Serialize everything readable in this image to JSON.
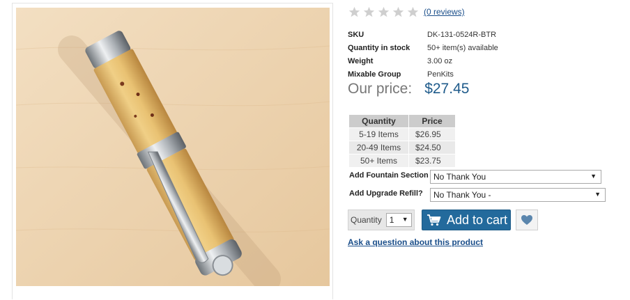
{
  "product": {
    "image_alt": "Fountain pen with burl wood body and chrome trim"
  },
  "rating": {
    "stars_filled": 0,
    "stars_total": 5,
    "reviews_link": "(0 reviews)"
  },
  "specs": [
    {
      "key": "SKU",
      "value": "DK-131-0524R-BTR"
    },
    {
      "key": "Quantity in stock",
      "value": "50+ item(s) available"
    },
    {
      "key": "Weight",
      "value": "3.00 oz"
    },
    {
      "key": "Mixable Group",
      "value": "PenKits"
    }
  ],
  "price": {
    "label": "Our price:",
    "value": "$27.45"
  },
  "tier_pricing": {
    "headers": [
      "Quantity",
      "Price"
    ],
    "rows": [
      [
        "5-19 Items",
        "$26.95"
      ],
      [
        "20-49 Items",
        "$24.50"
      ],
      [
        "50+ Items",
        "$23.75"
      ]
    ]
  },
  "options": [
    {
      "label": "Add Fountain Section?",
      "selected": "No Thank You"
    },
    {
      "label": "Add Upgrade Refill?",
      "selected": "No Thank You -"
    }
  ],
  "quantity": {
    "label": "Quantity",
    "selected": "1"
  },
  "actions": {
    "add_to_cart": "Add to cart",
    "ask_question": "Ask a question about this product"
  },
  "icons": {
    "star": "star-icon",
    "cart": "cart-icon",
    "wishlist": "heart-icon",
    "dropdown": "chevron-down-icon"
  },
  "colors": {
    "price_value": "#1f5b8b",
    "link": "#1a4e8a",
    "add_to_cart_bg": "#236a9c",
    "star_empty": "#cfcfcf",
    "table_header_bg": "#cccccc"
  }
}
